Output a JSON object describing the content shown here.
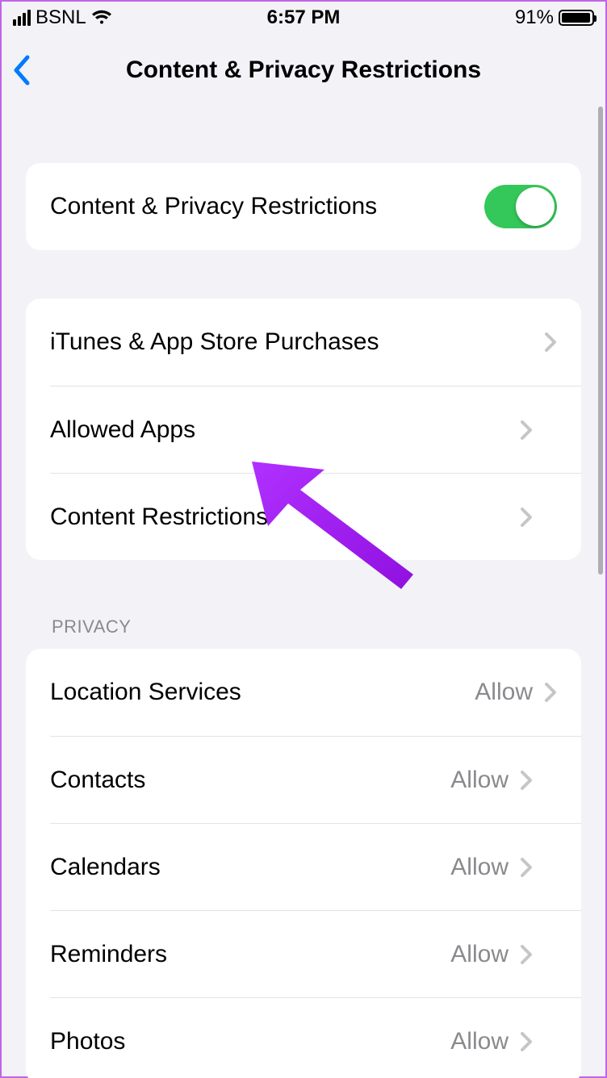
{
  "status": {
    "carrier": "BSNL",
    "time": "6:57 PM",
    "battery_pct": "91%"
  },
  "nav": {
    "title": "Content & Privacy Restrictions"
  },
  "toggle_row": {
    "label": "Content & Privacy Restrictions",
    "on": true
  },
  "group1": {
    "items": [
      {
        "label": "iTunes & App Store Purchases"
      },
      {
        "label": "Allowed Apps"
      },
      {
        "label": "Content Restrictions"
      }
    ]
  },
  "privacy": {
    "header": "PRIVACY",
    "items": [
      {
        "label": "Location Services",
        "value": "Allow"
      },
      {
        "label": "Contacts",
        "value": "Allow"
      },
      {
        "label": "Calendars",
        "value": "Allow"
      },
      {
        "label": "Reminders",
        "value": "Allow"
      },
      {
        "label": "Photos",
        "value": "Allow"
      }
    ]
  },
  "annotation": {
    "arrow_color": "#a020f0"
  }
}
